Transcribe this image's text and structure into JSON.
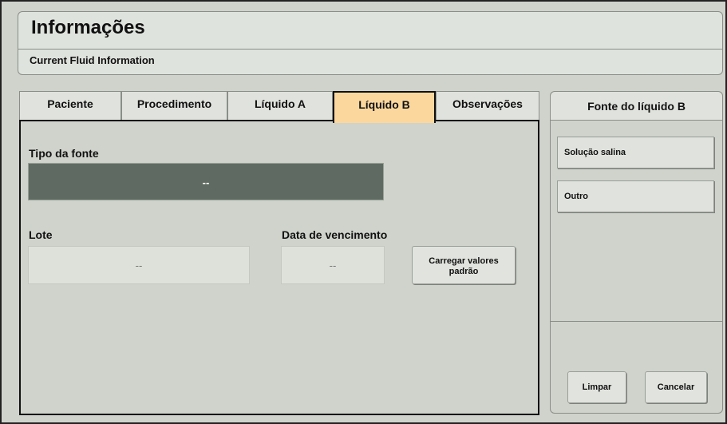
{
  "header": {
    "title": "Informações",
    "subtitle": "Current Fluid Information"
  },
  "tabs": [
    {
      "label": "Paciente",
      "active": false
    },
    {
      "label": "Procedimento",
      "active": false
    },
    {
      "label": "Líquido A",
      "active": false
    },
    {
      "label": "Líquido B",
      "active": true
    },
    {
      "label": "Observações",
      "active": false
    }
  ],
  "main": {
    "source_type_label": "Tipo da fonte",
    "source_type_value": "--",
    "lot_label": "Lote",
    "lot_value": "--",
    "expiry_label": "Data de vencimento",
    "expiry_value": "--",
    "load_defaults_line1": "Carregar valores",
    "load_defaults_line2": "padrão"
  },
  "side": {
    "title": "Fonte do líquido B",
    "options": [
      "Solução salina",
      "Outro"
    ],
    "clear_label": "Limpar",
    "cancel_label": "Cancelar"
  },
  "colors": {
    "background": "#cfd3cc",
    "active_tab": "#fbd79e",
    "selected_field": "#5f6b62"
  }
}
